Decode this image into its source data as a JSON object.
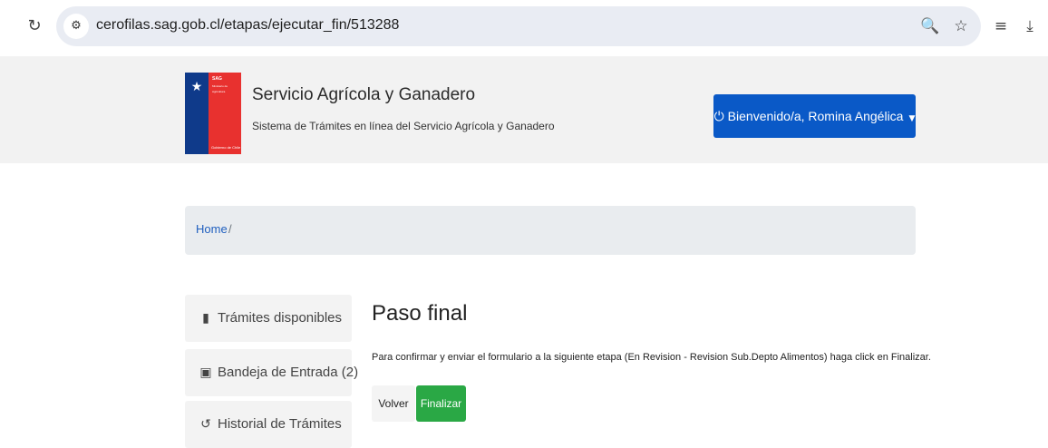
{
  "browser": {
    "url": "cerofilas.sag.gob.cl/etapas/ejecutar_fin/513288",
    "icons": [
      "reload-icon",
      "site-info-icon",
      "zoom-icon",
      "star-icon",
      "reading-list-icon",
      "download-icon"
    ]
  },
  "header": {
    "logo_text": "SAG",
    "logo_sub": "Ministerio de Agricultura",
    "logo_foot": "Gobierno de Chile",
    "title": "Servicio Agrícola y Ganadero",
    "subtitle": "Sistema de Trámites en línea del Servicio Agrícola y Ganadero",
    "user_button": "Bienvenido/a, Romina Angélica",
    "accent_color": "#0a59c7"
  },
  "breadcrumb": {
    "home": "Home",
    "separator": "/"
  },
  "sidebar": {
    "items": [
      {
        "label": "Trámites disponibles",
        "icon": "file-icon"
      },
      {
        "label": "Bandeja de Entrada (2)",
        "icon": "inbox-icon"
      },
      {
        "label": "Historial de Trámites",
        "icon": "history-icon"
      }
    ]
  },
  "main": {
    "title": "Paso final",
    "message": "Para confirmar y enviar el formulario a la siguiente etapa (En Revision - Revision Sub.Depto Alimentos) haga click en Finalizar.",
    "back_label": "Volver",
    "finish_label": "Finalizar",
    "finish_color": "#2aa845"
  }
}
